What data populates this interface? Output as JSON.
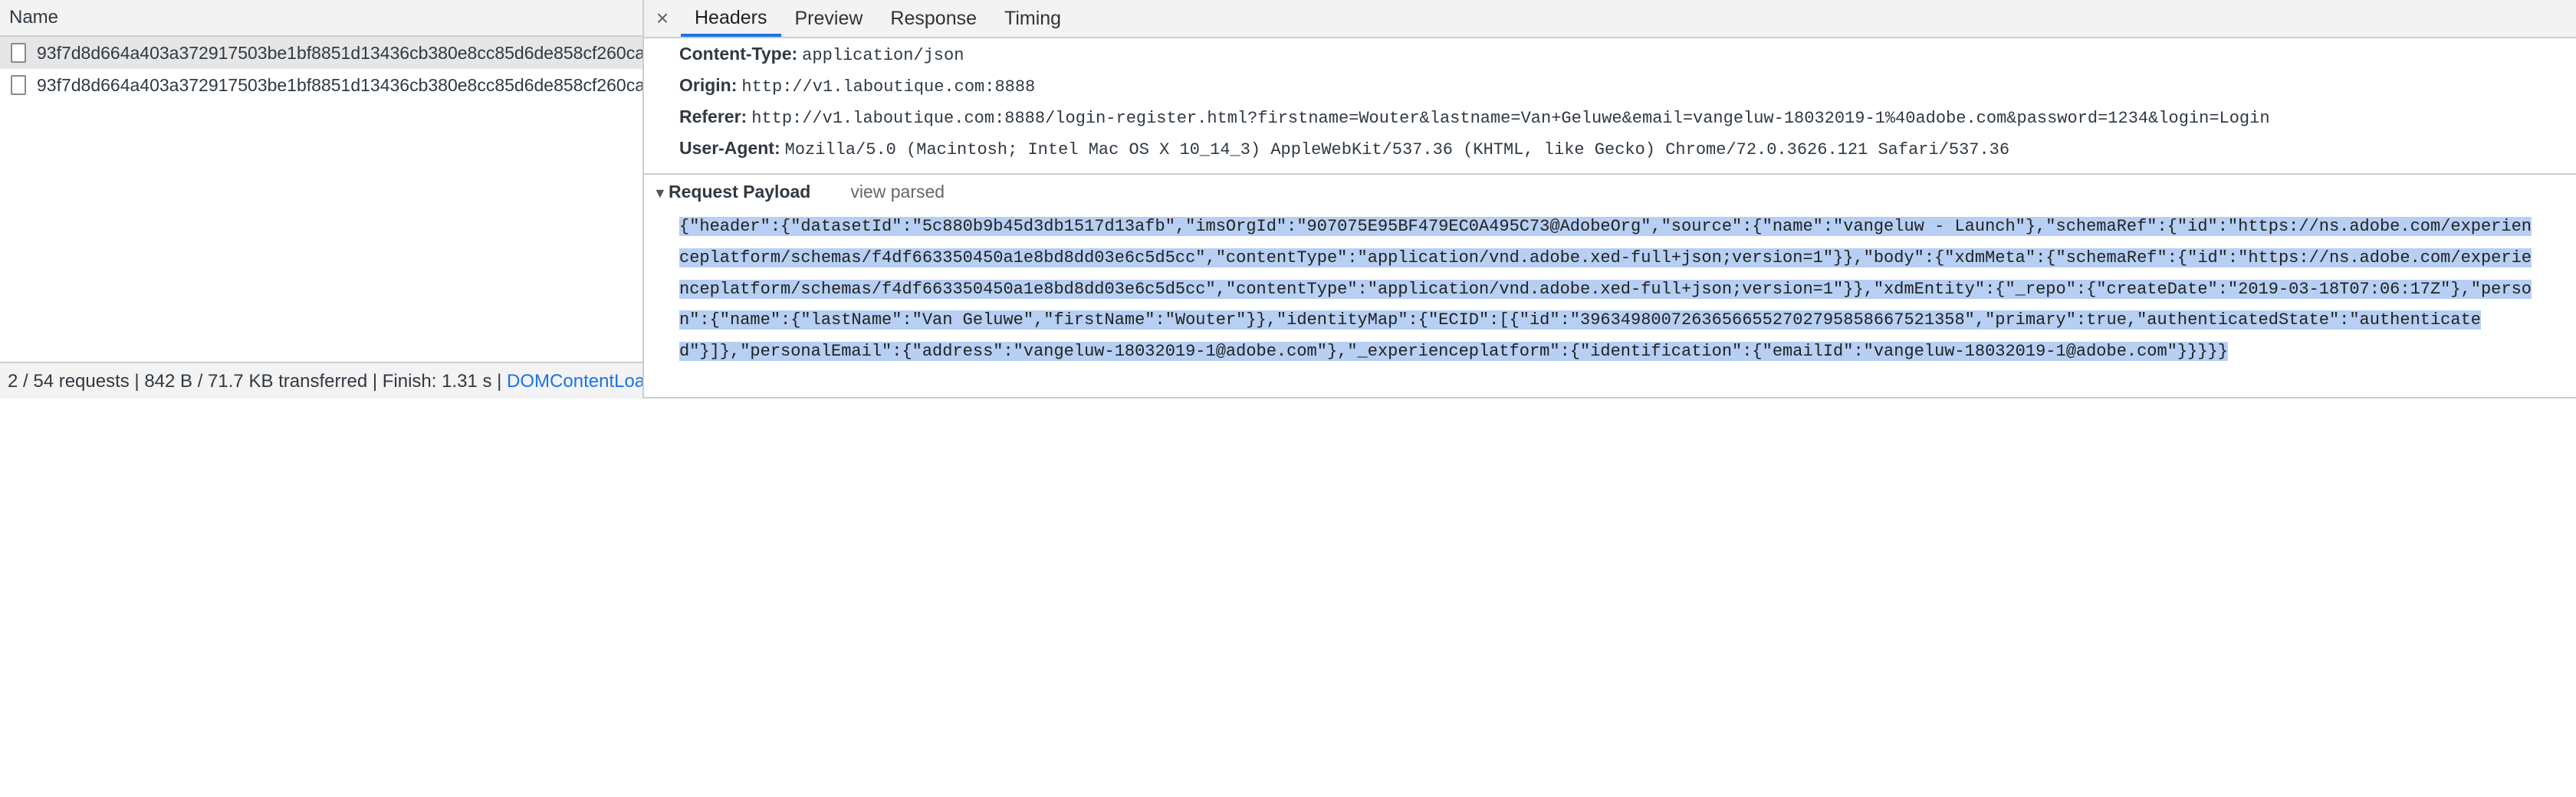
{
  "requests": {
    "column_name": "Name",
    "items": [
      {
        "name": "93f7d8d664a403a372917503be1bf8851d13436cb380e8cc85d6de858cf260ca"
      },
      {
        "name": "93f7d8d664a403a372917503be1bf8851d13436cb380e8cc85d6de858cf260ca"
      }
    ]
  },
  "status_bar": {
    "summary": "2 / 54 requests | 842 B / 71.7 KB transferred | Finish: 1.31 s | ",
    "link": "DOMContentLoad…"
  },
  "tabs": {
    "close": "×",
    "items": [
      {
        "label": "Headers"
      },
      {
        "label": "Preview"
      },
      {
        "label": "Response"
      },
      {
        "label": "Timing"
      }
    ]
  },
  "headers": [
    {
      "name": "Content-Type:",
      "value": "application/json"
    },
    {
      "name": "Origin:",
      "value": "http://v1.laboutique.com:8888"
    },
    {
      "name": "Referer:",
      "value": "http://v1.laboutique.com:8888/login-register.html?firstname=Wouter&lastname=Van+Geluwe&email=vangeluw-18032019-1%40adobe.com&password=1234&login=Login"
    },
    {
      "name": "User-Agent:",
      "value": "Mozilla/5.0 (Macintosh; Intel Mac OS X 10_14_3) AppleWebKit/537.36 (KHTML, like Gecko) Chrome/72.0.3626.121 Safari/537.36"
    }
  ],
  "payload_section": {
    "toggle": "▼",
    "title": "Request Payload",
    "view_parsed": "view parsed",
    "text": "{\"header\":{\"datasetId\":\"5c880b9b45d3db1517d13afb\",\"imsOrgId\":\"907075E95BF479EC0A495C73@AdobeOrg\",\"source\":{\"name\":\"vangeluw - Launch\"},\"schemaRef\":{\"id\":\"https://ns.adobe.com/experienceplatform/schemas/f4df663350450a1e8bd8dd03e6c5d5cc\",\"contentType\":\"application/vnd.adobe.xed-full+json;version=1\"}},\"body\":{\"xdmMeta\":{\"schemaRef\":{\"id\":\"https://ns.adobe.com/experienceplatform/schemas/f4df663350450a1e8bd8dd03e6c5d5cc\",\"contentType\":\"application/vnd.adobe.xed-full+json;version=1\"}},\"xdmEntity\":{\"_repo\":{\"createDate\":\"2019-03-18T07:06:17Z\"},\"person\":{\"name\":{\"lastName\":\"Van Geluwe\",\"firstName\":\"Wouter\"}},\"identityMap\":{\"ECID\":[{\"id\":\"39634980072636566552702795858667521358\",\"primary\":true,\"authenticatedState\":\"authenticated\"}]},\"personalEmail\":{\"address\":\"vangeluw-18032019-1@adobe.com\"},\"_experienceplatform\":{\"identification\":{\"emailId\":\"vangeluw-18032019-1@adobe.com\"}}}}}"
  }
}
